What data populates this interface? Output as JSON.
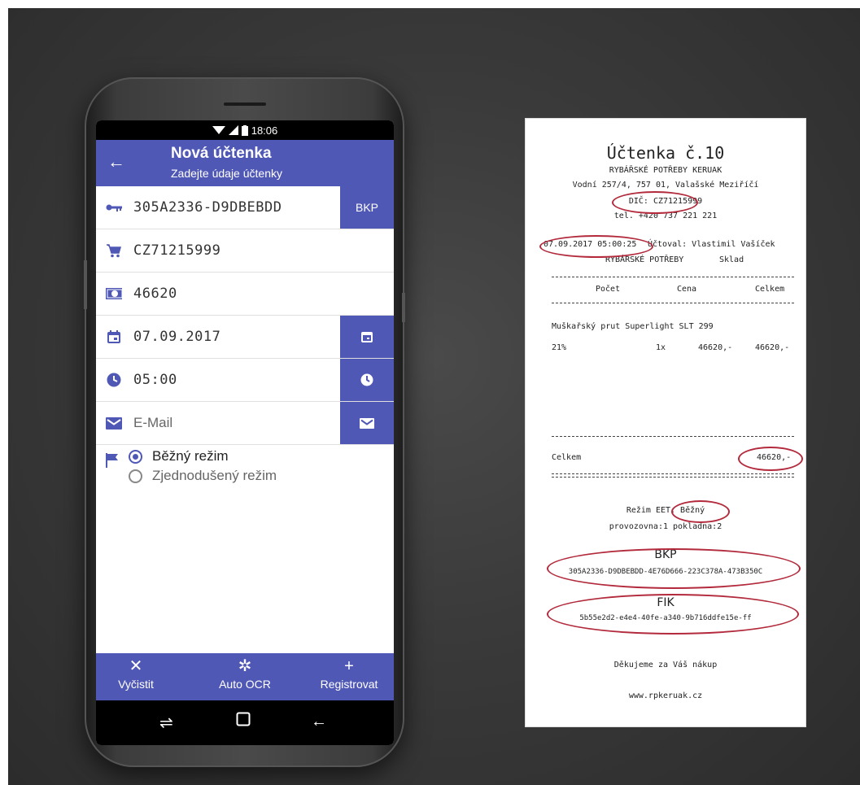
{
  "status": {
    "time": "18:06"
  },
  "appbar": {
    "title": "Nová účtenka",
    "subtitle": "Zadejte údaje účtenky"
  },
  "form": {
    "bkp_value": "305A2336-D9DBEBDD",
    "bkp_button": "BKP",
    "dic_value": "CZ71215999",
    "amount_value": "46620",
    "date_value": "07.09.2017",
    "time_value": "05:00",
    "email_placeholder": "E-Mail",
    "mode_options": [
      "Běžný režim",
      "Zjednodušený režim"
    ],
    "mode_selected": "Běžný režim"
  },
  "bottombar": {
    "clear": "Vyčistit",
    "ocr": "Auto OCR",
    "register": "Registrovat"
  },
  "receipt": {
    "title": "Účtenka č.10",
    "shop": "RYBÁŘSKÉ POTŘEBY KERUAK",
    "address": "Vodní 257/4, 757 01, Valašské Meziříčí",
    "dic": "DIČ: CZ71215999",
    "tel": "tel. +420 737 221 221",
    "datetime": "07.09.2017 05:00:25",
    "cashier": "Účtoval: Vlastimil Vašíček",
    "dept1": "RYBÁŘSKÉ POTŘEBY",
    "dept2": "Sklad",
    "col_count": "Počet",
    "col_price": "Cena",
    "col_total": "Celkem",
    "item_name": "Muškařský prut Superlight SLT 299",
    "item_vat": "21%",
    "item_qty": "1x",
    "item_price": "46620,-",
    "item_total": "46620,-",
    "total_label": "Celkem",
    "total_value": "46620,-",
    "eet_mode": "Režim EET: Běžný",
    "provozovna": "provozovna:1 pokladna:2",
    "bkp_label": "BKP",
    "bkp_code": "305A2336-D9DBEBDD-4E76D666-223C378A-473B350C",
    "fik_label": "FIK",
    "fik_code": "5b55e2d2-e4e4-40fe-a340-9b716ddfe15e-ff",
    "thanks": "Děkujeme za Váš nákup",
    "web": "www.rpkeruak.cz"
  },
  "colors": {
    "primary": "#5058b6",
    "annotation": "#b22a3c"
  }
}
